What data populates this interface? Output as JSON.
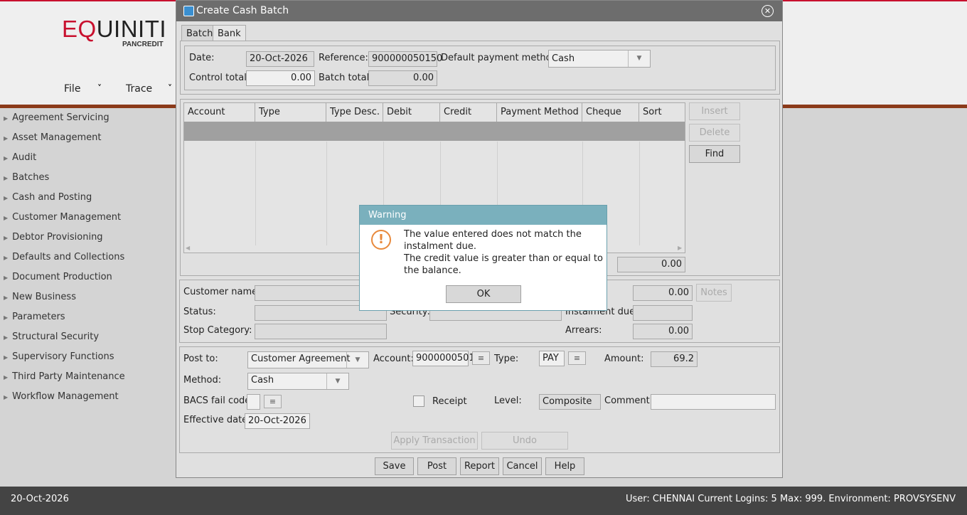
{
  "app": {
    "logo_main_red": "EQ",
    "logo_main_rest": "UINITI",
    "logo_sub": "PANCREDIT",
    "menu": [
      {
        "label": "File"
      },
      {
        "label": "Trace"
      }
    ],
    "sidebar": [
      "Agreement Servicing",
      "Asset Management",
      "Audit",
      "Batches",
      "Cash and Posting",
      "Customer Management",
      "Debtor Provisioning",
      "Defaults and Collections",
      "Document Production",
      "New Business",
      "Parameters",
      "Structural Security",
      "Supervisory Functions",
      "Third Party Maintenance",
      "Workflow Management"
    ],
    "footer": {
      "date": "20-Oct-2026",
      "user_info": "User: CHENNAI  Current Logins: 5  Max: 999.  Environment: PROVSYSENV"
    }
  },
  "dialog": {
    "title": "Create Cash Batch",
    "tabs": [
      "Batch",
      "Bank"
    ],
    "batch": {
      "date_label": "Date:",
      "date_value": "20-Oct-2026",
      "reference_label": "Reference:",
      "reference_value": "900000050150",
      "default_payment_label": "Default payment method:",
      "default_payment_value": "Cash",
      "control_total_label": "Control total:",
      "control_total_value": "0.00",
      "batch_total_label": "Batch total:",
      "batch_total_value": "0.00"
    },
    "grid": {
      "columns": [
        "Account",
        "Type",
        "Type Desc.",
        "Debit",
        "Credit",
        "Payment Method",
        "Cheque No.",
        "Sort Code"
      ],
      "total_label_fragment": "l:",
      "total_value": "0.00"
    },
    "side_buttons": {
      "insert": "Insert",
      "delete": "Delete",
      "find": "Find"
    },
    "customer": {
      "name_label": "Customer name:",
      "status_label": "Status:",
      "security_label": "Security:",
      "instalment_due_label": "Instalment due:",
      "stop_category_label": "Stop Category:",
      "arrears_label": "Arrears:",
      "balance_value": "0.00",
      "arrears_value": "0.00",
      "notes_label": "Notes"
    },
    "posting": {
      "post_to_label": "Post to:",
      "post_to_value": "Customer Agreement",
      "account_label": "Account:",
      "account_value": "9000000501",
      "type_label": "Type:",
      "type_value": "PAY",
      "amount_label": "Amount:",
      "amount_value": "69.2",
      "method_label": "Method:",
      "method_value": "Cash",
      "bacs_label": "BACS fail code:",
      "receipt_label": "Receipt",
      "level_label": "Level:",
      "level_value": "Composite",
      "comment_label": "Comment:",
      "effective_date_label": "Effective date:",
      "effective_date_value": "20-Oct-2026",
      "apply_label": "Apply Transaction",
      "undo_label": "Undo"
    },
    "footer_buttons": [
      "Save",
      "Post",
      "Report",
      "Cancel",
      "Help"
    ]
  },
  "warning": {
    "title": "Warning",
    "line1": "The value entered does not match the instalment due.",
    "line2": "The credit value is greater than or equal to the balance.",
    "ok_label": "OK"
  }
}
